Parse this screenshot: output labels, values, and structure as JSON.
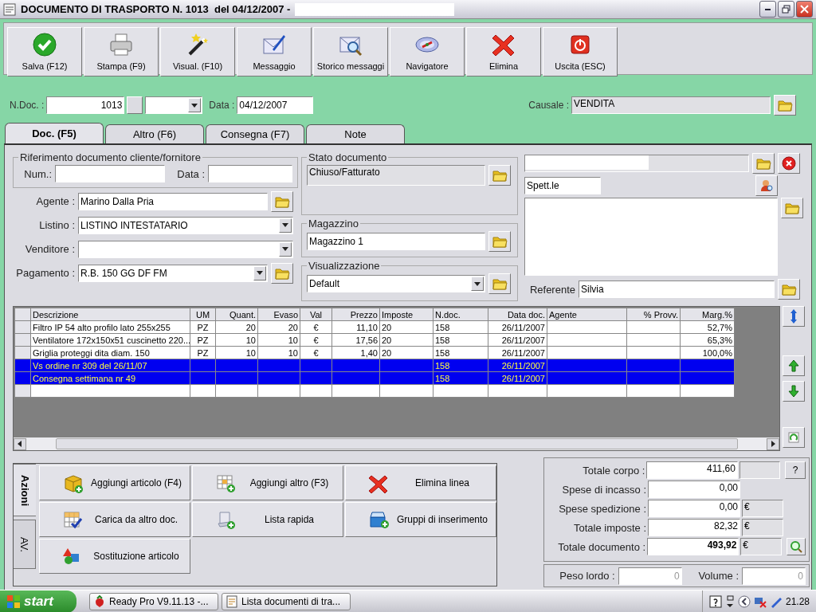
{
  "window": {
    "title": "DOCUMENTO DI TRASPORTO N. 1013  del 04/12/2007 -"
  },
  "toolbar": [
    {
      "label": "Salva (F12)"
    },
    {
      "label": "Stampa (F9)"
    },
    {
      "label": "Visual. (F10)"
    },
    {
      "label": "Messaggio"
    },
    {
      "label": "Storico messaggi"
    },
    {
      "label": "Navigatore"
    },
    {
      "label": "Elimina"
    },
    {
      "label": "Uscita (ESC)"
    }
  ],
  "header": {
    "ndoc_label": "N.Doc. :",
    "ndoc_value": "1013",
    "date_label": "Data :",
    "date_value": "04/12/2007",
    "causale_label": "Causale :",
    "causale_value": "VENDITA"
  },
  "tabs": [
    {
      "label": "Doc. (F5)",
      "selected": true
    },
    {
      "label": "Altro (F6)",
      "selected": false
    },
    {
      "label": "Consegna (F7)",
      "selected": false
    },
    {
      "label": "Note",
      "selected": false
    }
  ],
  "reference_group": {
    "title": "Riferimento documento cliente/fornitore",
    "num_label": "Num.:",
    "date_label": "Data :"
  },
  "fields": [
    {
      "label": "Agente :",
      "value": "Marino Dalla Pria",
      "kind": "text",
      "folder": true
    },
    {
      "label": "Listino :",
      "value": "LISTINO INTESTATARIO",
      "kind": "combo",
      "folder": false
    },
    {
      "label": "Venditore :",
      "kind": "combo",
      "folder": false
    },
    {
      "label": "Pagamento :",
      "value": "R.B. 150 GG DF FM",
      "kind": "combo",
      "folder": true
    }
  ],
  "status_group": {
    "title": "Stato documento",
    "value": "Chiuso/Fatturato"
  },
  "warehouse_group": {
    "title": "Magazzino",
    "value": "Magazzino 1"
  },
  "view_group": {
    "title": "Visualizzazione",
    "value": "Default"
  },
  "customer": {
    "salutation": "Spett.le",
    "contact_label": "Referente",
    "contact_value": "Silvia"
  },
  "table": {
    "columns": [
      "Descrizione",
      "UM",
      "Quant.",
      "Evaso",
      "Val",
      "Prezzo",
      "Imposte",
      "N.doc.",
      "Data doc.",
      "Agente",
      "% Provv.",
      "Marg.%"
    ],
    "rows": [
      {
        "cells": [
          "Filtro IP 54 alto profilo lato 255x255",
          "PZ",
          "20",
          "20",
          "€",
          "11,10",
          "20",
          "158",
          "26/11/2007",
          null,
          null,
          "52,7%"
        ],
        "selected": false
      },
      {
        "cells": [
          "Ventilatore 172x150x51 cuscinetto 220...",
          "PZ",
          "10",
          "10",
          "€",
          "17,56",
          "20",
          "158",
          "26/11/2007",
          null,
          null,
          "65,3%"
        ],
        "selected": false
      },
      {
        "cells": [
          "Griglia proteggi dita diam. 150",
          "PZ",
          "10",
          "10",
          "€",
          "1,40",
          "20",
          "158",
          "26/11/2007",
          null,
          null,
          "100,0%"
        ],
        "selected": false
      },
      {
        "cells": [
          "Vs ordine nr 309 del 26/11/07",
          null,
          null,
          null,
          null,
          null,
          null,
          "158",
          "26/11/2007",
          null,
          null,
          null
        ],
        "selected": true
      },
      {
        "cells": [
          "Consegna settimana nr 49",
          null,
          null,
          null,
          null,
          null,
          null,
          "158",
          "26/11/2007",
          null,
          null,
          null
        ],
        "selected": true
      }
    ]
  },
  "action_tabs": [
    {
      "label": "Azioni",
      "selected": true
    },
    {
      "label": "AV.",
      "selected": false
    }
  ],
  "actions": [
    {
      "label": "Aggiungi articolo (F4)"
    },
    {
      "label": "Aggiungi altro (F3)"
    },
    {
      "label": "Elimina linea"
    },
    {
      "label": "Carica da altro doc."
    },
    {
      "label": "Lista rapida"
    },
    {
      "label": "Gruppi di inserimento"
    },
    {
      "label": "Sostituzione articolo"
    }
  ],
  "totals": [
    {
      "label": "Totale corpo :",
      "value": "411,60",
      "kind": "help",
      "extra": "?",
      "bold": false
    },
    {
      "label": "Spese di incasso :",
      "value": "0,00",
      "kind": "plain",
      "bold": false
    },
    {
      "label": "Spese spedizione :",
      "value": "0,00",
      "kind": "unit",
      "unit": "€",
      "bold": false
    },
    {
      "label": "Totale imposte :",
      "value": "82,32",
      "kind": "unit",
      "unit": "€",
      "bold": false
    },
    {
      "label": "Totale documento :",
      "value": "493,92",
      "kind": "zoom",
      "unit": "€",
      "bold": true
    }
  ],
  "weights": [
    {
      "label": "Peso lordo :",
      "value": "0"
    },
    {
      "label": "Volume :",
      "value": "0"
    }
  ],
  "taskbar": {
    "start": "start",
    "tasks": [
      {
        "label": "Ready Pro V9.11.13 -..."
      },
      {
        "label": "Lista documenti di tra..."
      }
    ],
    "clock": "21.28"
  }
}
